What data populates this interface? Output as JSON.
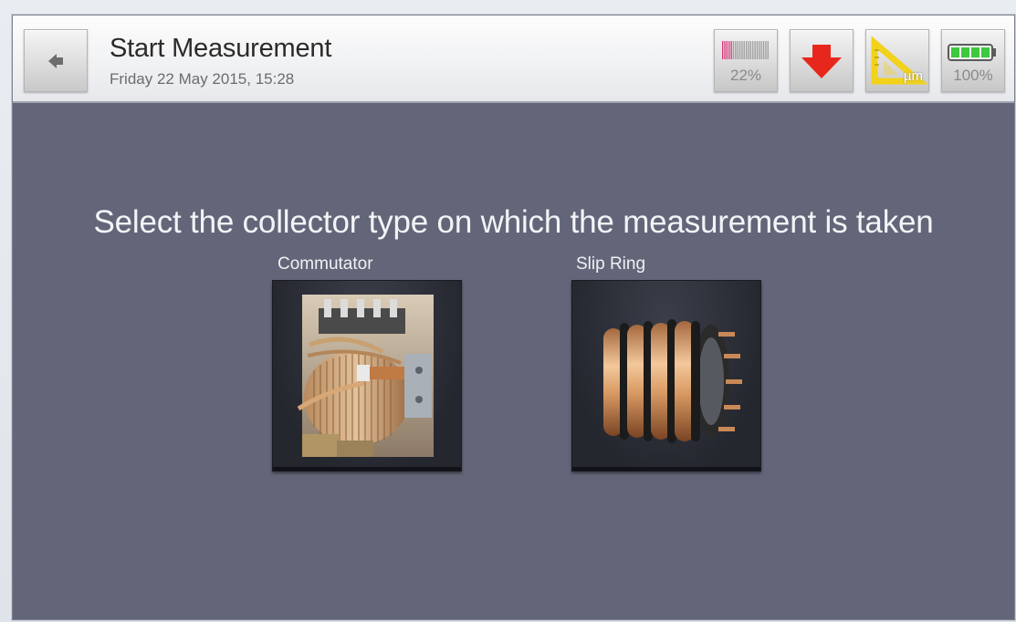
{
  "header": {
    "title": "Start Measurement",
    "subtitle": "Friday 22 May 2015, 15:28"
  },
  "toolbar": {
    "signal": {
      "value_label": "22%",
      "icon": "signal-strength-icon",
      "level": 0.22
    },
    "download": {
      "icon": "download-arrow-icon",
      "color": "#e8271c"
    },
    "units": {
      "label": "µm",
      "icon": "ruler-triangle-icon",
      "color": "#f2d21a"
    },
    "battery": {
      "value_label": "100%",
      "icon": "battery-icon",
      "level": 1.0,
      "color": "#3ec83e"
    }
  },
  "main": {
    "prompt": "Select the collector type on which the measurement is taken",
    "options": [
      {
        "label": "Commutator",
        "icon": "commutator-image"
      },
      {
        "label": "Slip Ring",
        "icon": "slip-ring-image"
      }
    ]
  },
  "colors": {
    "background": "#626678",
    "header": "#f0f1f3",
    "accent_red": "#e8271c",
    "accent_yellow": "#f2d21a",
    "battery_green": "#3ec83e"
  }
}
